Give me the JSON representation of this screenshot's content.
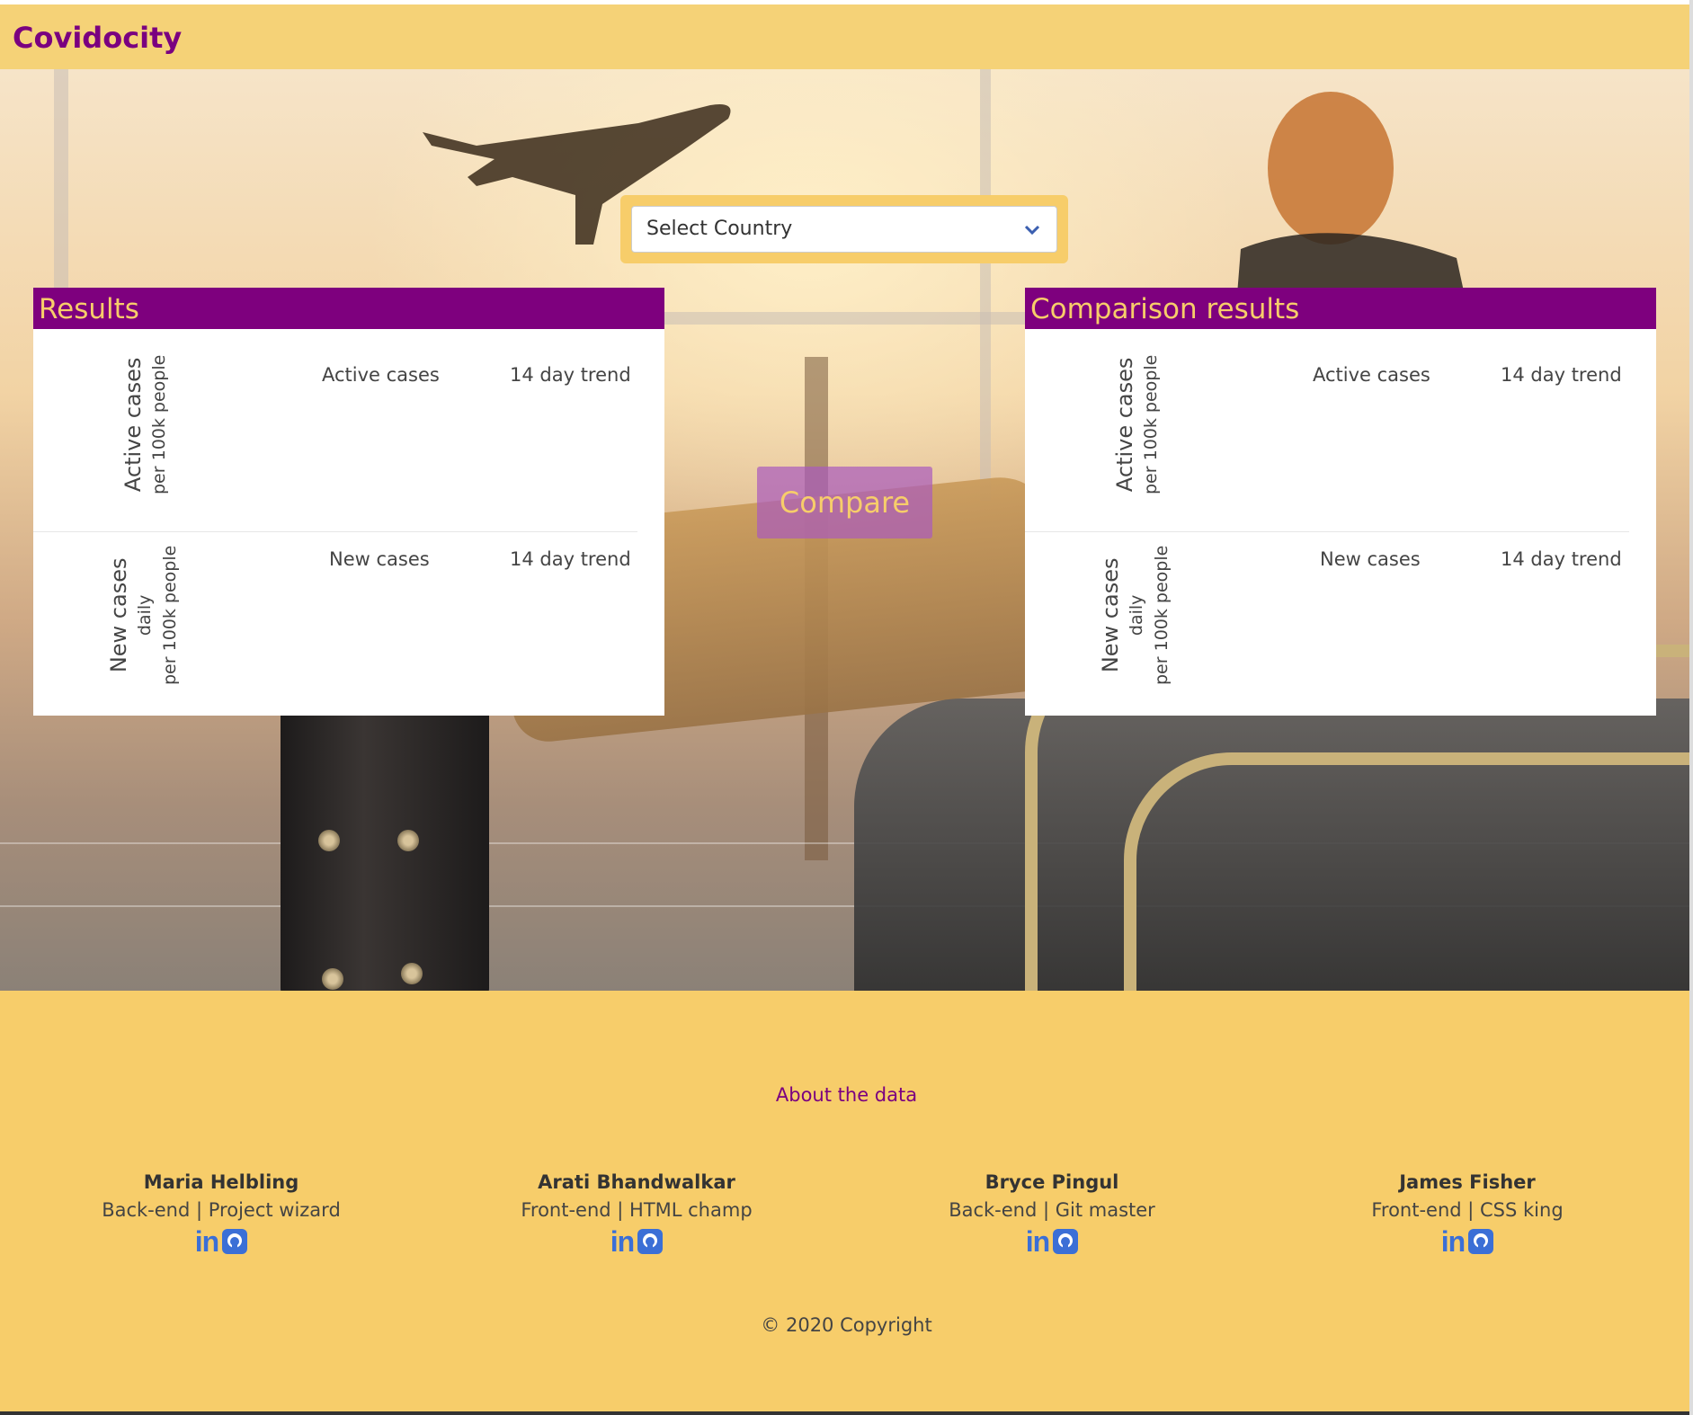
{
  "navbar": {
    "brand": "Covidocity"
  },
  "selector": {
    "placeholder": "Select Country"
  },
  "results": {
    "title": "Results",
    "active_row": {
      "label_main": "Active cases",
      "label_sub": "per 100k people",
      "col1": "Active cases",
      "col2": "14 day trend"
    },
    "new_row": {
      "label_main": "New cases",
      "label_mid": "daily",
      "label_sub": "per 100k people",
      "col1": "New cases",
      "col2": "14 day trend"
    }
  },
  "comparison": {
    "title": "Comparison results",
    "active_row": {
      "label_main": "Active cases",
      "label_sub": "per 100k people",
      "col1": "Active cases",
      "col2": "14 day trend"
    },
    "new_row": {
      "label_main": "New cases",
      "label_mid": "daily",
      "label_sub": "per 100k people",
      "col1": "New cases",
      "col2": "14 day trend"
    }
  },
  "compare_button": {
    "label": "Compare"
  },
  "footer": {
    "about_link": "About the data",
    "team": [
      {
        "name": "Maria Helbling",
        "role": "Back-end | Project wizard"
      },
      {
        "name": "Arati Bhandwalkar",
        "role": "Front-end | HTML champ"
      },
      {
        "name": "Bryce Pingul",
        "role": "Back-end | Git master"
      },
      {
        "name": "James Fisher",
        "role": "Front-end | CSS king"
      }
    ],
    "icons": {
      "linkedin": "linkedin-icon",
      "github": "github-icon",
      "linkedin_text": "in"
    },
    "copyright": "© 2020 Copyright"
  },
  "colors": {
    "brand_purple": "#7e007e",
    "accent_yellow": "#f7cd6a",
    "link_blue": "#3b6fd6"
  }
}
